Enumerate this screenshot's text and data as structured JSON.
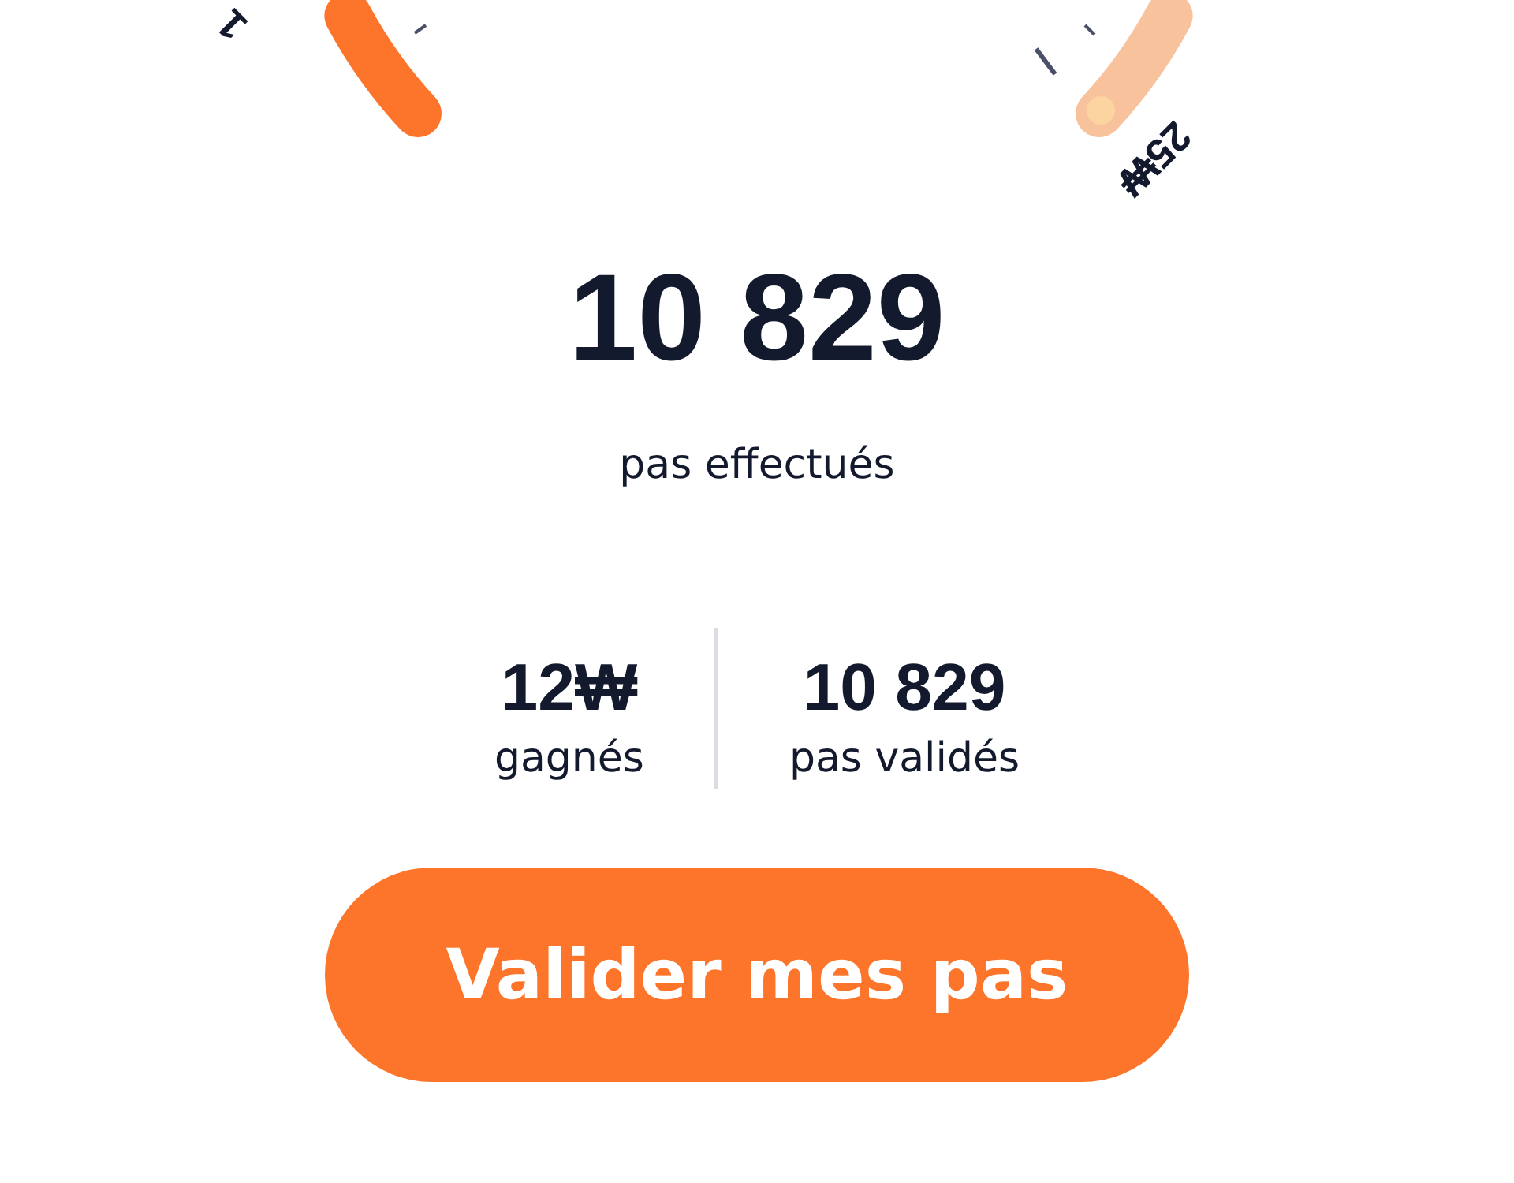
{
  "gauge": {
    "left_label": "1",
    "right_label": "25₩"
  },
  "steps": {
    "value": "10 829",
    "label": "pas effectués"
  },
  "stats": [
    {
      "value": "12₩",
      "label": "gagnés"
    },
    {
      "value": "10 829",
      "label": "pas validés"
    }
  ],
  "button": {
    "label": "Valider mes pas"
  }
}
